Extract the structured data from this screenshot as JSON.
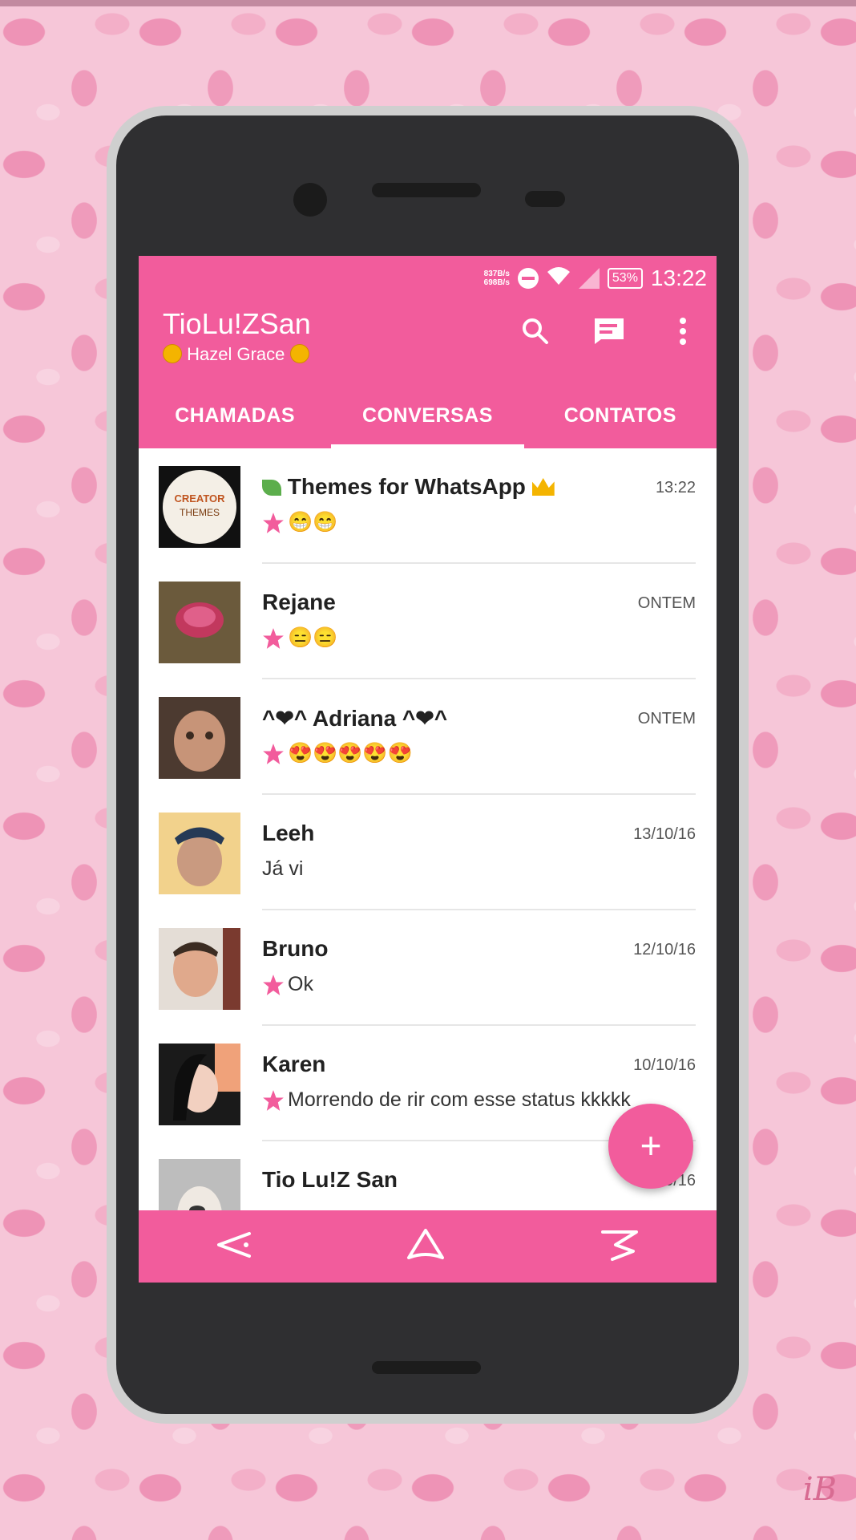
{
  "status_bar": {
    "speed_up": "837B/s",
    "speed_down": "698B/s",
    "battery": "53%",
    "time": "13:22"
  },
  "app": {
    "title": "TioLu!ZSan",
    "subtitle": "Hazel Grace"
  },
  "tabs": [
    {
      "label": "CHAMADAS"
    },
    {
      "label": "CONVERSAS"
    },
    {
      "label": "CONTATOS"
    }
  ],
  "active_tab": "CONVERSAS",
  "chats": [
    {
      "name": "Themes for WhatsApp",
      "time": "13:22",
      "message": "",
      "emoji": "😁😁"
    },
    {
      "name": "Rejane",
      "time": "ONTEM",
      "message": "",
      "emoji": "😑😑"
    },
    {
      "name": "^❤^ Adriana ^❤^",
      "time": "ONTEM",
      "message": "",
      "emoji": "😍😍😍😍😍"
    },
    {
      "name": "Leeh",
      "time": "13/10/16",
      "message": "Já vi",
      "emoji": ""
    },
    {
      "name": "Bruno",
      "time": "12/10/16",
      "message": "Ok",
      "emoji": ""
    },
    {
      "name": "Karen",
      "time": "10/10/16",
      "message": "Morrendo de rir com esse status kkkkk",
      "emoji": ""
    },
    {
      "name": "Tio Lu!Z San",
      "time": "12/10/16",
      "message": "",
      "emoji": ""
    }
  ],
  "fab": {
    "label": "+"
  },
  "signature": "iB",
  "colors": {
    "accent": "#f25c9c",
    "background": "#f6c6d8",
    "spots": "#ee93b6"
  }
}
